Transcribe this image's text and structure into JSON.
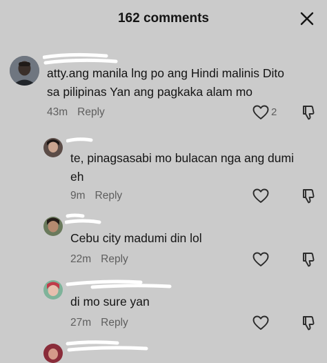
{
  "header": {
    "title": "162 comments"
  },
  "comments": [
    {
      "text": "atty.ang manila lng po ang Hindi malinis Dito\nsa pilipinas Yan ang pagkaka alam mo",
      "time": "43m",
      "reply": "Reply",
      "likes": "2"
    },
    {
      "text": "te, pinagsasabi mo bulacan nga ang dumi\neh",
      "time": "9m",
      "reply": "Reply"
    },
    {
      "text": "Cebu city madumi din lol",
      "time": "22m",
      "reply": "Reply"
    },
    {
      "text": "di mo sure yan",
      "time": "27m",
      "reply": "Reply"
    }
  ],
  "icons": {
    "close": "close-icon",
    "like": "heart-icon",
    "dislike": "thumbs-down-icon"
  },
  "colors": {
    "background": "#cbcbcb",
    "text": "#141414",
    "meta": "#5e5e5e"
  }
}
